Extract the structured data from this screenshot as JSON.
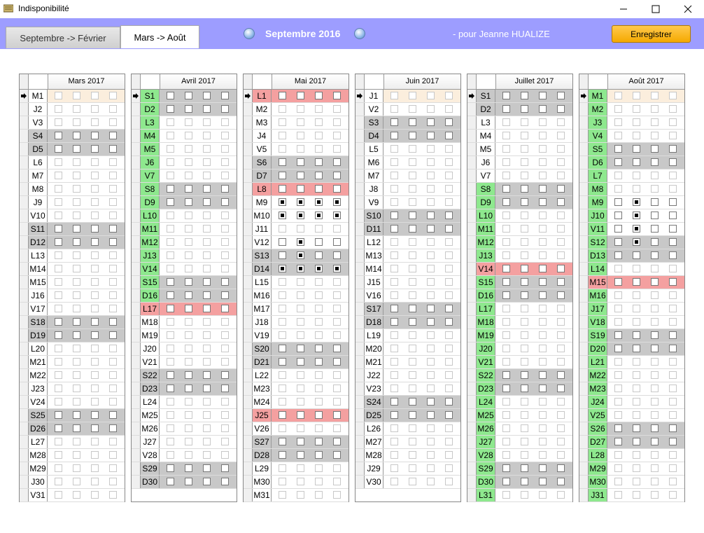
{
  "window": {
    "title": "Indisponibilité",
    "minimize": "—",
    "maximize": "☐",
    "close": "✕"
  },
  "tabs": [
    {
      "label": "Septembre -> Février"
    },
    {
      "label": "Mars -> Août"
    }
  ],
  "header": {
    "month": "Septembre 2016",
    "person": "- pour Jeanne HUALIZE",
    "save_label": "Enregistrer"
  },
  "colors": {
    "toolbar": "#9d9dff",
    "weekend": "#c8c8c8",
    "holiday": "#f4a0a0",
    "green": "#8ee88e",
    "current": "#fbeedd"
  },
  "months": [
    {
      "name": "Mars 2017",
      "days": [
        "M1",
        "J2",
        "V3",
        "S4",
        "D5",
        "L6",
        "M7",
        "M8",
        "J9",
        "V10",
        "S11",
        "D12",
        "L13",
        "M14",
        "M15",
        "J16",
        "V17",
        "S18",
        "D19",
        "L20",
        "M21",
        "M22",
        "J23",
        "V24",
        "S25",
        "D26",
        "L27",
        "M28",
        "M29",
        "J30",
        "V31"
      ],
      "weekend": [
        3,
        4,
        10,
        11,
        17,
        18,
        24,
        25
      ],
      "holiday": [],
      "green": [],
      "red": [],
      "current": 0,
      "dots": {}
    },
    {
      "name": "Avril 2017",
      "days": [
        "S1",
        "D2",
        "L3",
        "M4",
        "M5",
        "J6",
        "V7",
        "S8",
        "D9",
        "L10",
        "M11",
        "M12",
        "J13",
        "V14",
        "S15",
        "D16",
        "L17",
        "M18",
        "M19",
        "J20",
        "V21",
        "S22",
        "D23",
        "L24",
        "M25",
        "M26",
        "J27",
        "V28",
        "S29",
        "D30"
      ],
      "weekend": [
        0,
        1,
        7,
        8,
        14,
        15,
        21,
        22,
        28,
        29
      ],
      "holiday": [
        16
      ],
      "green": [
        0,
        1,
        2,
        3,
        4,
        5,
        6,
        7,
        8,
        9,
        10,
        11,
        12,
        13,
        14,
        15
      ],
      "red": [
        16
      ],
      "current": 0,
      "dots": {}
    },
    {
      "name": "Mai 2017",
      "days": [
        "L1",
        "M2",
        "M3",
        "J4",
        "V5",
        "S6",
        "D7",
        "L8",
        "M9",
        "M10",
        "J11",
        "V12",
        "S13",
        "D14",
        "L15",
        "M16",
        "M17",
        "J18",
        "V19",
        "S20",
        "D21",
        "L22",
        "M23",
        "M24",
        "J25",
        "V26",
        "S27",
        "D28",
        "L29",
        "M30",
        "M31"
      ],
      "weekend": [
        5,
        6,
        12,
        13,
        19,
        20,
        26,
        27
      ],
      "holiday": [
        0,
        7,
        24
      ],
      "green": [],
      "red": [
        0,
        7,
        24
      ],
      "current": 0,
      "dots": {
        "8": [
          0,
          1,
          2,
          3
        ],
        "9": [
          0,
          1,
          2,
          3
        ],
        "11": [
          1
        ],
        "12": [
          1
        ],
        "13": [
          0,
          1,
          2,
          3
        ]
      }
    },
    {
      "name": "Juin 2017",
      "days": [
        "J1",
        "V2",
        "S3",
        "D4",
        "L5",
        "M6",
        "M7",
        "J8",
        "V9",
        "S10",
        "D11",
        "L12",
        "M13",
        "M14",
        "J15",
        "V16",
        "S17",
        "D18",
        "L19",
        "M20",
        "M21",
        "J22",
        "V23",
        "S24",
        "D25",
        "L26",
        "M27",
        "M28",
        "J29",
        "V30"
      ],
      "weekend": [
        2,
        3,
        9,
        10,
        16,
        17,
        23,
        24
      ],
      "holiday": [],
      "green": [],
      "red": [],
      "current": 0,
      "dots": {}
    },
    {
      "name": "Juillet 2017",
      "days": [
        "S1",
        "D2",
        "L3",
        "M4",
        "M5",
        "J6",
        "V7",
        "S8",
        "D9",
        "L10",
        "M11",
        "M12",
        "J13",
        "V14",
        "S15",
        "D16",
        "L17",
        "M18",
        "M19",
        "J20",
        "V21",
        "S22",
        "D23",
        "L24",
        "M25",
        "M26",
        "J27",
        "V28",
        "S29",
        "D30",
        "L31"
      ],
      "weekend": [
        0,
        1,
        7,
        8,
        14,
        15,
        21,
        22,
        28,
        29
      ],
      "holiday": [
        13
      ],
      "green": [
        7,
        8,
        9,
        10,
        11,
        12,
        14,
        15,
        16,
        17,
        18,
        19,
        20,
        21,
        22,
        23,
        24,
        25,
        26,
        27,
        28,
        29,
        30
      ],
      "red": [
        13
      ],
      "current": 0,
      "dots": {}
    },
    {
      "name": "Août 2017",
      "days": [
        "M1",
        "M2",
        "J3",
        "V4",
        "S5",
        "D6",
        "L7",
        "M8",
        "M9",
        "J10",
        "V11",
        "S12",
        "D13",
        "L14",
        "M15",
        "M16",
        "J17",
        "V18",
        "S19",
        "D20",
        "L21",
        "M22",
        "M23",
        "J24",
        "V25",
        "S26",
        "D27",
        "L28",
        "M29",
        "M30",
        "J31"
      ],
      "weekend": [
        4,
        5,
        11,
        12,
        18,
        19,
        25,
        26
      ],
      "holiday": [
        14
      ],
      "green": [
        0,
        1,
        2,
        3,
        4,
        5,
        6,
        7,
        8,
        9,
        10,
        11,
        12,
        13,
        15,
        16,
        17,
        18,
        19,
        20,
        21,
        22,
        23,
        24,
        25,
        26,
        27,
        28,
        29,
        30
      ],
      "red": [
        14
      ],
      "current": 0,
      "dots": {
        "8": [
          1
        ],
        "9": [
          1
        ],
        "10": [
          1
        ],
        "11": [
          1
        ]
      }
    }
  ]
}
